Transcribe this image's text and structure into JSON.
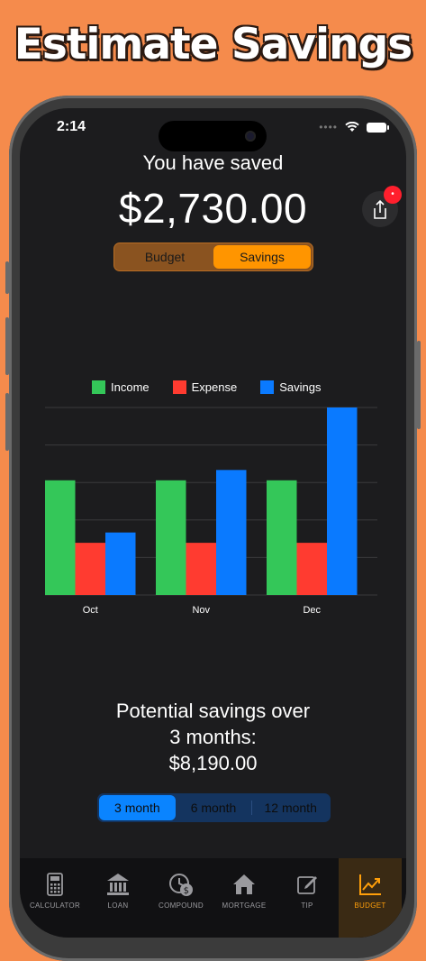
{
  "headline": "Estimate Savings",
  "status": {
    "time": "2:14"
  },
  "header": {
    "saved_label": "You have saved",
    "saved_amount": "$2,730.00"
  },
  "mode_tabs": [
    {
      "label": "Budget",
      "active": false
    },
    {
      "label": "Savings",
      "active": true
    }
  ],
  "legend": [
    {
      "label": "Income",
      "color": "#34c759"
    },
    {
      "label": "Expense",
      "color": "#ff3b30"
    },
    {
      "label": "Savings",
      "color": "#0a7aff"
    }
  ],
  "chart_data": {
    "type": "bar",
    "categories": [
      "Oct",
      "Nov",
      "Dec"
    ],
    "series": [
      {
        "name": "Income",
        "values": [
          2000,
          2000,
          2000
        ]
      },
      {
        "name": "Expense",
        "values": [
          910,
          910,
          910
        ]
      },
      {
        "name": "Savings",
        "values": [
          1090,
          2180,
          3270
        ]
      }
    ],
    "ylim": [
      0,
      3270
    ],
    "grid": true,
    "legend_position": "top"
  },
  "potential": {
    "line1": "Potential savings over",
    "line2": "3 months:",
    "amount": "$8,190.00"
  },
  "period_tabs": [
    {
      "label": "3 month",
      "active": true
    },
    {
      "label": "6 month",
      "active": false
    },
    {
      "label": "12 month",
      "active": false
    }
  ],
  "tabbar": [
    {
      "label": "CALCULATOR",
      "icon": "calculator-icon",
      "active": false
    },
    {
      "label": "LOAN",
      "icon": "bank-icon",
      "active": false
    },
    {
      "label": "COMPOUND",
      "icon": "compound-clock-icon",
      "active": false
    },
    {
      "label": "MORTGAGE",
      "icon": "house-icon",
      "active": false
    },
    {
      "label": "TIP",
      "icon": "edit-icon",
      "active": false
    },
    {
      "label": "BUDGET",
      "icon": "chart-icon",
      "active": true
    }
  ]
}
